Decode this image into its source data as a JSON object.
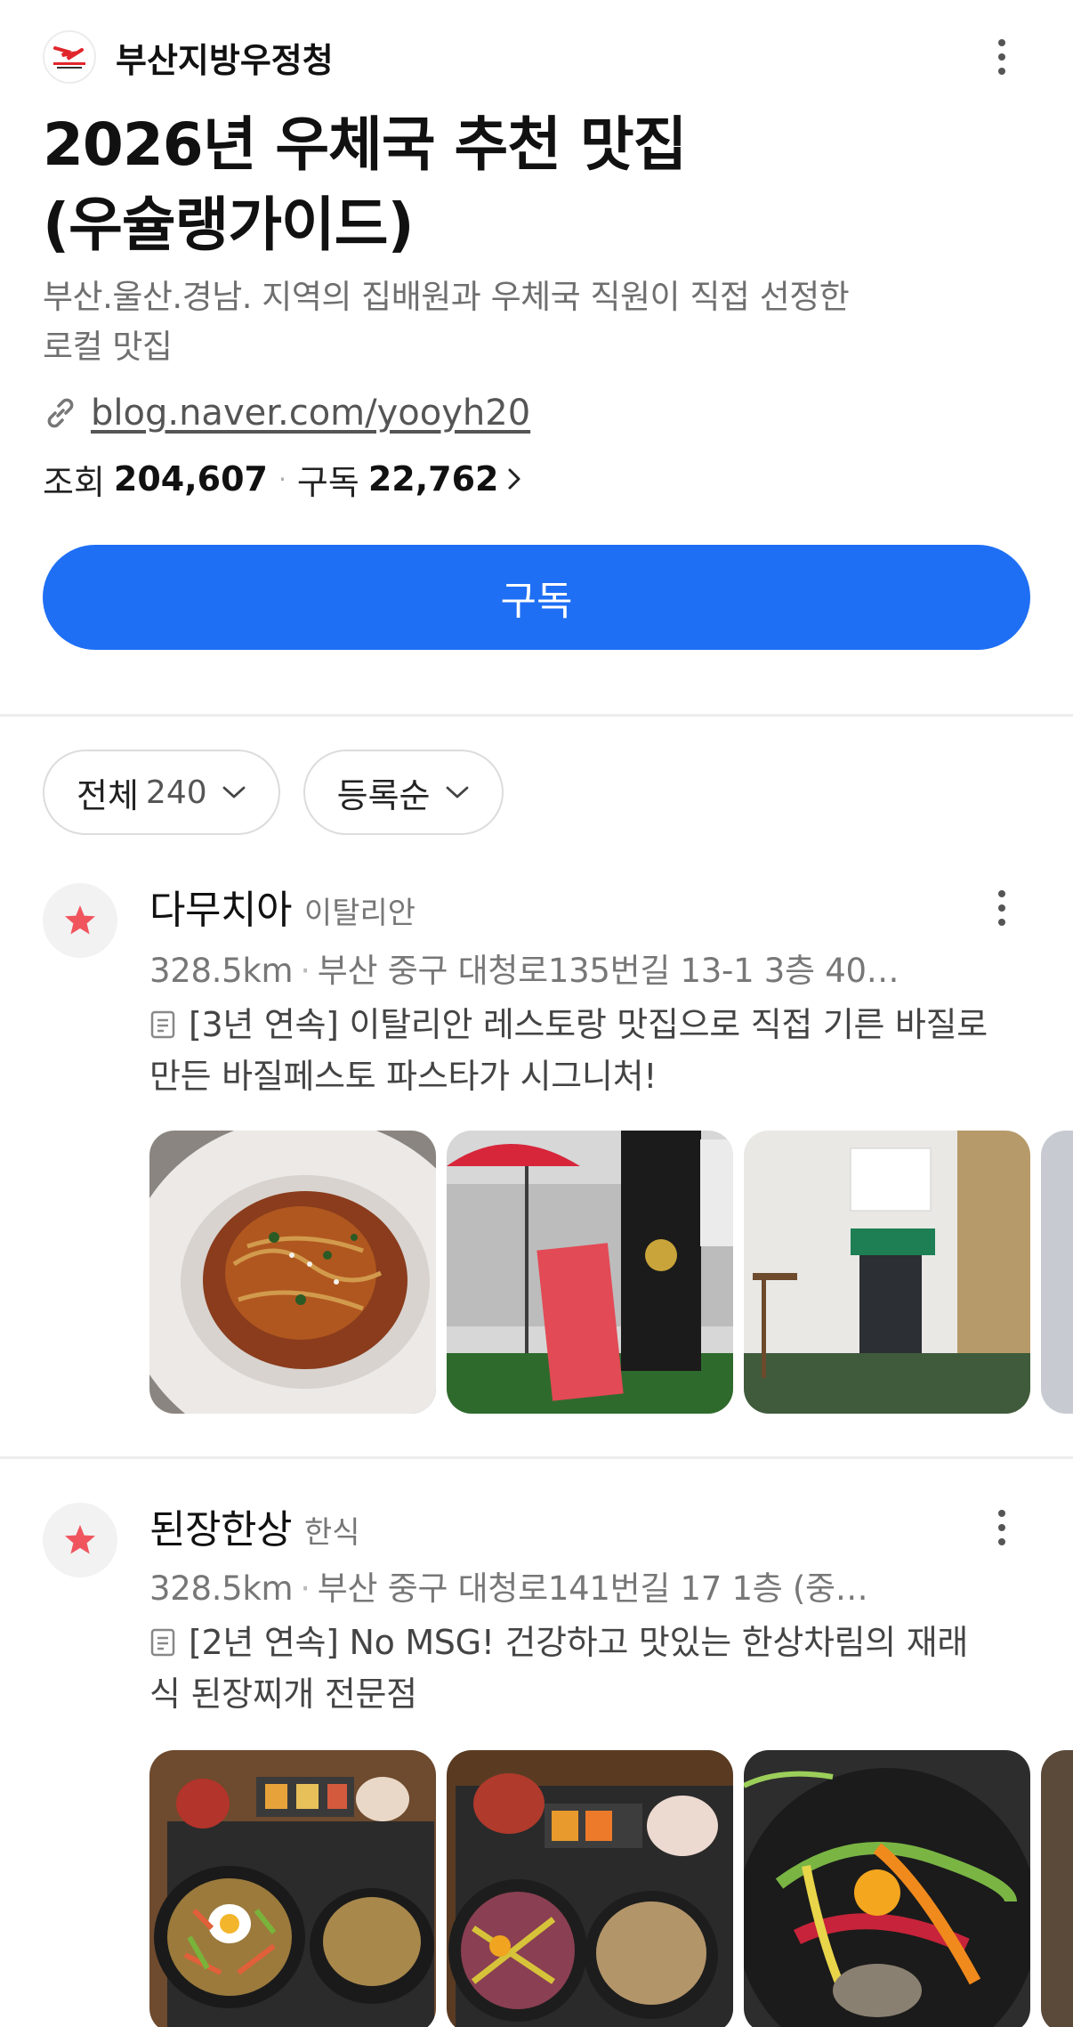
{
  "account": {
    "name": "부산지방우정청",
    "logo_icon": "korea-post-logo-icon"
  },
  "page": {
    "title_line1": "2026년 우체국 추천 맛집",
    "title_line2": "(우슐랭가이드)",
    "desc_line1": "부산.울산.경남. 지역의 집배원과 우체국 직원이 직접 선정한",
    "desc_line2": "로컬 맛집",
    "link": "blog.naver.com/yooyh20"
  },
  "stats": {
    "views_label": "조회",
    "views": "204,607",
    "subs_label": "구독",
    "subs": "22,762"
  },
  "subscribe_label": "구독",
  "filters": {
    "all_label": "전체",
    "all_count": "240",
    "sort_label": "등록순"
  },
  "places": [
    {
      "name": "다무치아",
      "category": "이탈리안",
      "distance": "328.5km",
      "address": "부산 중구 대청로135번길 13-1 3층 40…",
      "desc_line1": "[3년 연속] 이탈리안 레스토랑 맛집으로 직접 기른 바질로",
      "desc_line2": "만든 바질페스토 파스타가 시그니처!"
    },
    {
      "name": "된장한상",
      "category": "한식",
      "distance": "328.5km",
      "address": "부산 중구 대청로141번길 17 1층 (중…",
      "desc_line1": "[2년 연속] No MSG! 건강하고 맛있는 한상차림의 재래",
      "desc_line2": "식 된장찌개 전문점"
    }
  ],
  "colors": {
    "accent": "#1f6ff5",
    "star": "#f0555e"
  }
}
